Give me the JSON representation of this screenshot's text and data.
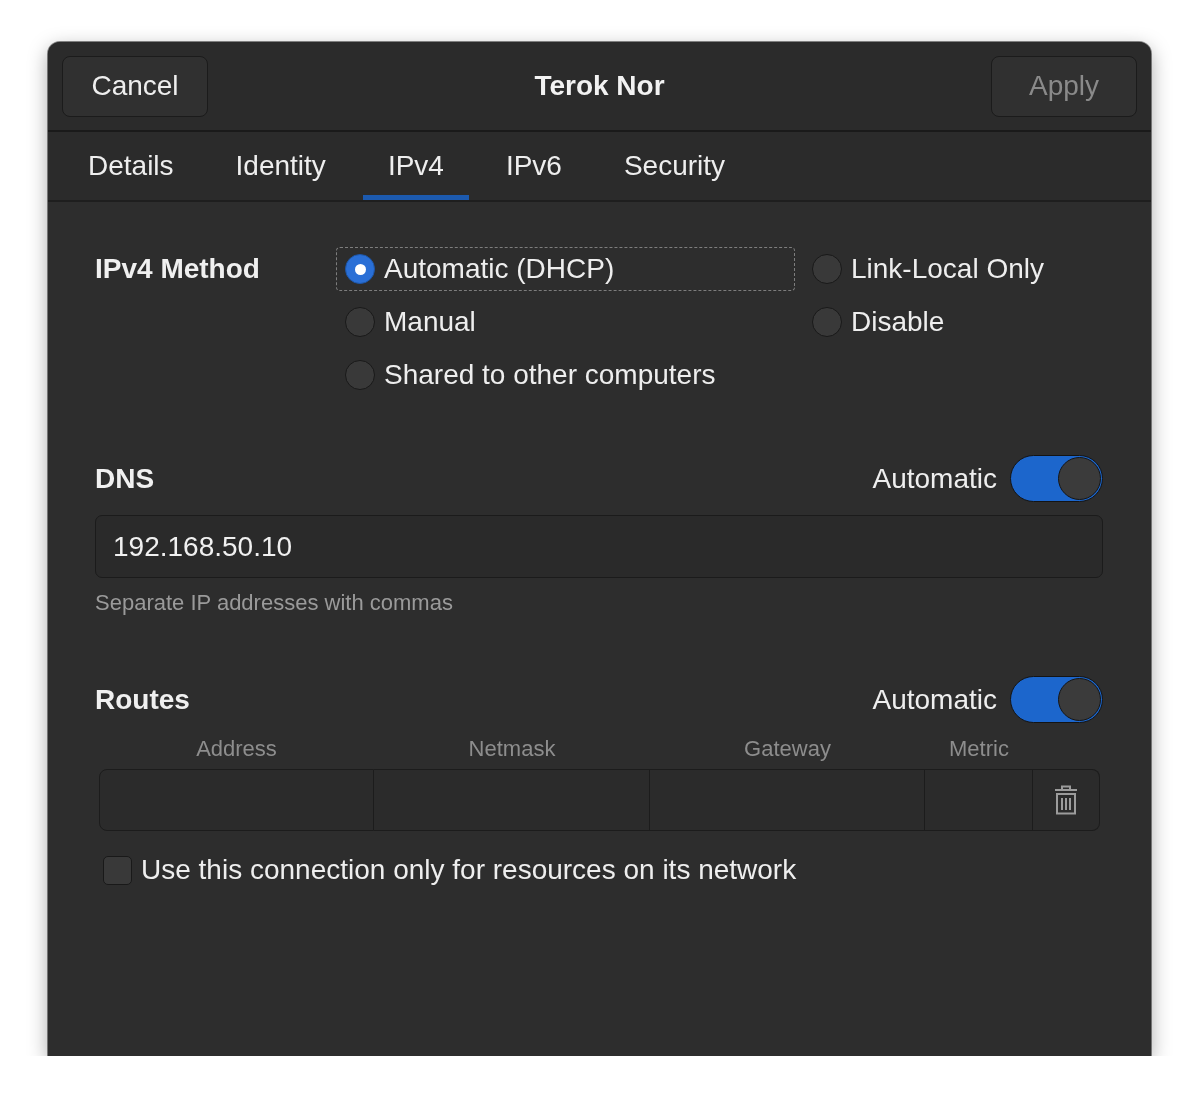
{
  "header": {
    "start_button": {
      "label": "Cancel",
      "disabled": false
    },
    "title": "Terok Nor",
    "end_button": {
      "label": "Apply",
      "disabled": true
    }
  },
  "tabs": [
    {
      "label": "Details",
      "selected": false
    },
    {
      "label": "Identity",
      "selected": false
    },
    {
      "label": "IPv4",
      "selected": true
    },
    {
      "label": "IPv6",
      "selected": false
    },
    {
      "label": "Security",
      "selected": false
    }
  ],
  "ipv4_method": {
    "label": "IPv4 Method",
    "options": [
      {
        "label": "Automatic (DHCP)",
        "selected": true,
        "focused": true
      },
      {
        "label": "Link-Local Only",
        "selected": false,
        "focused": false
      },
      {
        "label": "Manual",
        "selected": false,
        "focused": false
      },
      {
        "label": "Disable",
        "selected": false,
        "focused": false
      },
      {
        "label": "Shared to other computers",
        "selected": false,
        "focused": false
      }
    ]
  },
  "dns": {
    "label": "DNS",
    "switch": {
      "label": "Automatic",
      "on": true
    },
    "value": "192.168.50.10",
    "hint": "Separate IP addresses with commas"
  },
  "routes": {
    "label": "Routes",
    "switch": {
      "label": "Automatic",
      "on": true
    },
    "columns": [
      "Address",
      "Netmask",
      "Gateway",
      "Metric"
    ]
  },
  "only_local_resources": {
    "label": "Use this connection only for resources on its network",
    "checked": false
  }
}
